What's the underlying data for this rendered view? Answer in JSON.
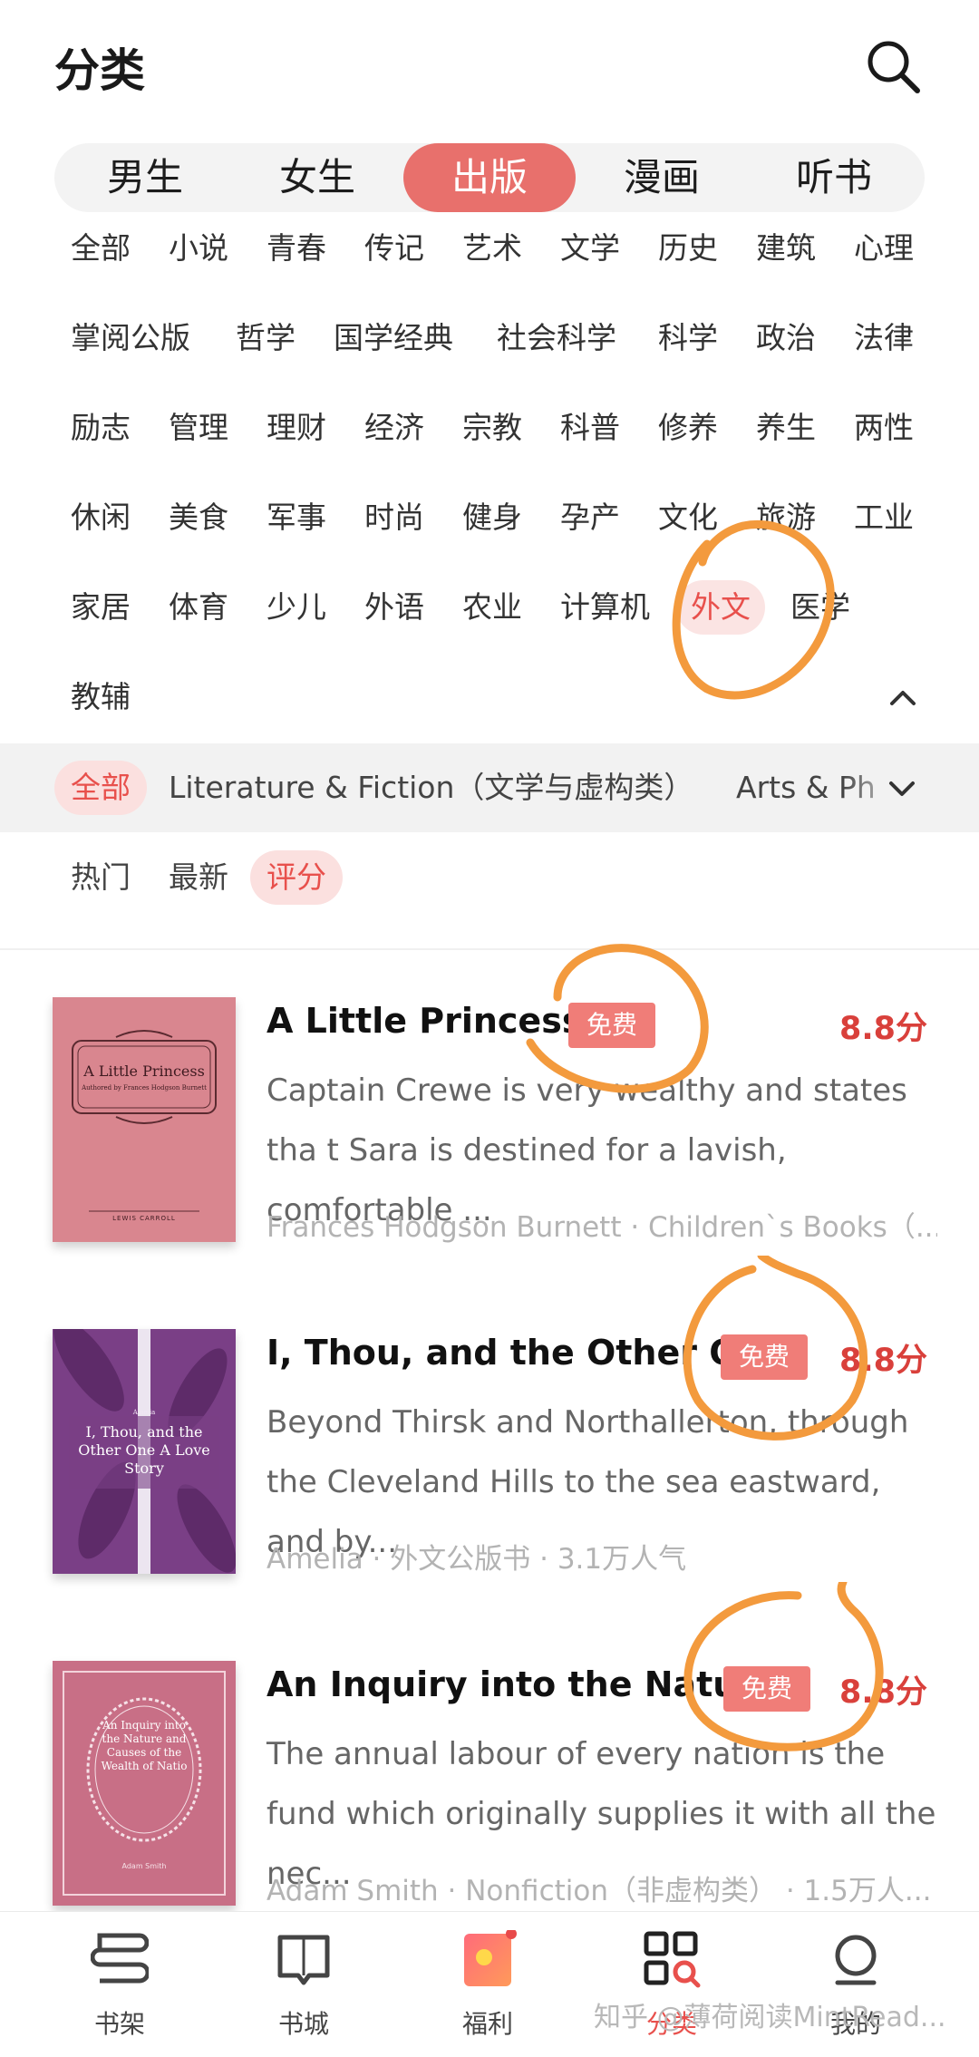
{
  "header": {
    "title": "分类",
    "search_icon": "search-icon"
  },
  "tabs": [
    {
      "label": "男生",
      "active": false
    },
    {
      "label": "女生",
      "active": false
    },
    {
      "label": "出版",
      "active": true
    },
    {
      "label": "漫画",
      "active": false
    },
    {
      "label": "听书",
      "active": false
    }
  ],
  "tags": [
    [
      "全部",
      "小说",
      "青春",
      "传记",
      "艺术",
      "文学",
      "历史",
      "建筑",
      "心理"
    ],
    [
      "掌阅公版",
      "哲学",
      "国学经典",
      "社会科学",
      "科学",
      "政治",
      "法律"
    ],
    [
      "励志",
      "管理",
      "理财",
      "经济",
      "宗教",
      "科普",
      "修养",
      "养生",
      "两性"
    ],
    [
      "休闲",
      "美食",
      "军事",
      "时尚",
      "健身",
      "孕产",
      "文化",
      "旅游",
      "工业"
    ],
    [
      "家居",
      "体育",
      "少儿",
      "外语",
      "农业",
      "计算机",
      "外文",
      "医学"
    ],
    [
      "教辅"
    ]
  ],
  "selected_tag": "外文",
  "subcategories": [
    {
      "label": "全部",
      "active": true
    },
    {
      "label": "Literature & Fiction（文学与虚构类）",
      "active": false
    },
    {
      "label": "Arts & Ph",
      "active": false
    }
  ],
  "sort_options": [
    {
      "label": "热门",
      "active": false
    },
    {
      "label": "最新",
      "active": false
    },
    {
      "label": "评分",
      "active": true
    }
  ],
  "books": [
    {
      "title": "A Little Princess",
      "badge": "免费",
      "score": "8.8分",
      "desc": "Captain Crewe is very wealthy and states tha t Sara is destined for a lavish, comfortable ...",
      "meta": "Frances Hodgson Burnett · Children`s Books（...",
      "cover": {
        "color": "#d9858e",
        "title": "A Little Princess",
        "subtitle": "Authored by Frances Hodgson Burnett",
        "footer": "LEWIS CARROLL"
      }
    },
    {
      "title": "I, Thou, and the Other O...",
      "badge": "免费",
      "score": "8.8分",
      "desc": "Beyond Thirsk and Northallerton, through the  Cleveland Hills to the sea eastward, and by...",
      "meta": "Amelia · 外文公版书 · 3.1万人气",
      "cover": {
        "color": "#7b3f85",
        "title": "I, Thou, and the Other One A Love Story",
        "subtitle": "Amelia",
        "footer": ""
      }
    },
    {
      "title": "An Inquiry into the Natu...",
      "badge": "免费",
      "score": "8.8分",
      "desc": "The annual labour of every nation is the fund which originally supplies it with all the nec...",
      "meta": "Adam Smith · Nonfiction（非虚构类） · 1.5万人...",
      "cover": {
        "color": "#c96f86",
        "title": "An Inquiry into the Nature and Causes of the Wealth of Natio",
        "subtitle": "",
        "footer": "Adam Smith"
      }
    }
  ],
  "bottom_nav": [
    {
      "label": "书架",
      "icon": "bookshelf-icon",
      "active": false
    },
    {
      "label": "书城",
      "icon": "book-store-icon",
      "active": false
    },
    {
      "label": "福利",
      "icon": "gift-icon",
      "active": false
    },
    {
      "label": "分类",
      "icon": "category-icon",
      "active": true
    },
    {
      "label": "我的",
      "icon": "profile-icon",
      "active": false
    }
  ],
  "watermark": "知乎 @薄荷阅读MintRead...",
  "colors": {
    "accent": "#e8706c",
    "score": "#d9403b",
    "annotation": "#f39a3d"
  }
}
